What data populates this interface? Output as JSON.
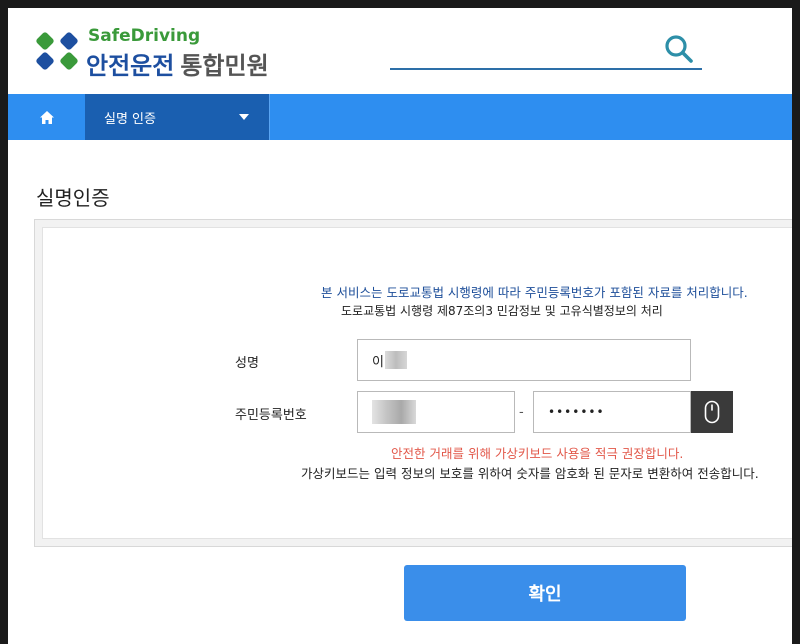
{
  "header": {
    "brand_en": "SafeDriving",
    "brand_ko": "안전운전",
    "brand_sub": "통합민원",
    "search_icon": "search-icon",
    "colors": {
      "brand_green": "#3a9a3a",
      "brand_blue": "#1d4fa0",
      "search_teal": "#2d8fa8"
    }
  },
  "nav": {
    "home_icon": "home-icon",
    "menu_label": "실명 인증",
    "caret_icon": "caret-down-icon",
    "colors": {
      "bar": "#2e8ef0",
      "active": "#1a5fb0"
    }
  },
  "page": {
    "title": "실명인증"
  },
  "form": {
    "notice_blue": "본 서비스는 도로교통법 시행령에 따라 주민등록번호가 포함된 자료를 처리합니다.",
    "notice_black": "도로교통법 시행령 제87조의3 민감정보 및 고유식별정보의 처리",
    "name_label": "성명",
    "name_value_prefix": "이",
    "rrn_label": "주민등록번호",
    "rrn_separator": "-",
    "rrn_back_masked": "•••••••",
    "virtual_keyboard_icon": "mouse-icon",
    "warn_red": "안전한 거래를 위해 가상키보드 사용을 적극 권장합니다.",
    "warn_black": "가상키보드는 입력 정보의 보호를 위하여 숫자를 암호화 된 문자로 변환하여 전송합니다."
  },
  "actions": {
    "confirm_label": "확인",
    "colors": {
      "confirm": "#3a8eea"
    }
  }
}
